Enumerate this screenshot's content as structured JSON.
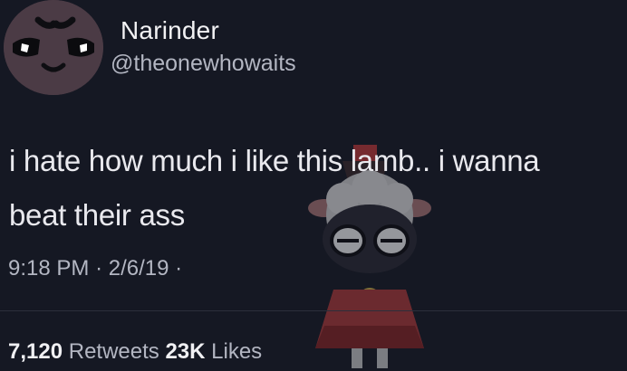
{
  "user": {
    "display_name": "Narinder",
    "handle": "@theonewhowaits"
  },
  "tweet": {
    "text_line1": "i hate how much i like this lamb.. i wanna",
    "text_line2": "beat their ass",
    "time": "9:18 PM",
    "date": "2/6/19",
    "sep1": "·",
    "sep2": "·"
  },
  "stats": {
    "retweets_count": "7,120",
    "retweets_label": "Retweets",
    "likes_count": "23K",
    "likes_label": "Likes"
  },
  "colors": {
    "background": "#151823",
    "primary_text": "#e9e9ee",
    "secondary_text": "#b3b6c2"
  },
  "icons": {
    "avatar": "angry-face-avatar",
    "sticker": "lamb-sticker"
  }
}
